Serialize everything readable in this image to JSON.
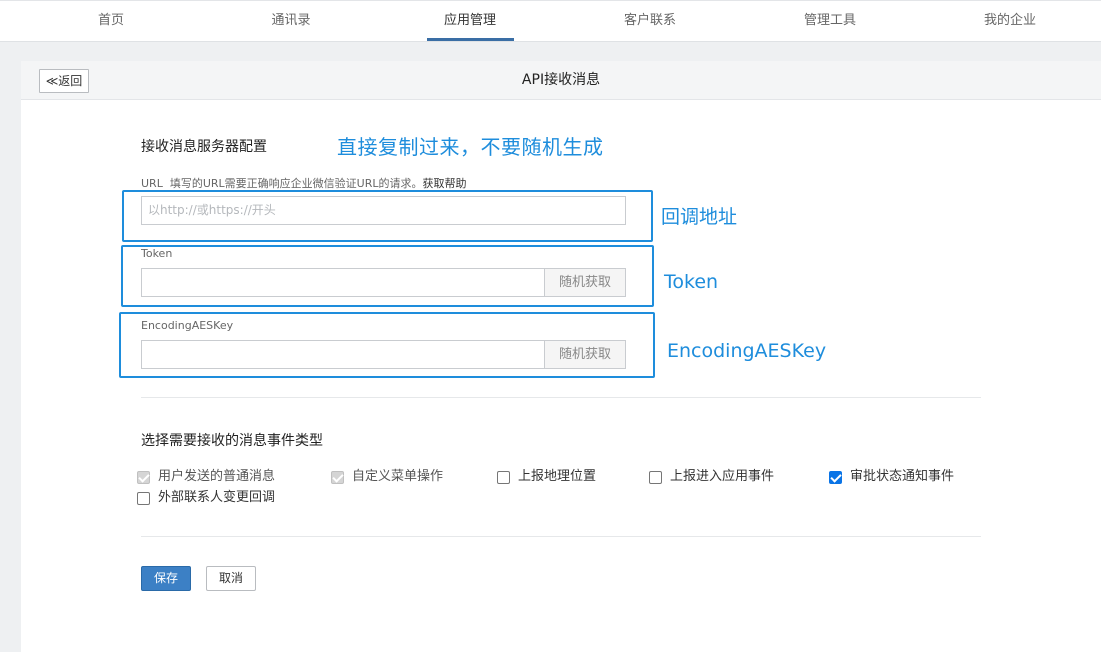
{
  "nav": {
    "items": [
      {
        "label": "首页"
      },
      {
        "label": "通讯录"
      },
      {
        "label": "应用管理"
      },
      {
        "label": "客户联系"
      },
      {
        "label": "管理工具"
      },
      {
        "label": "我的企业"
      }
    ],
    "active_index": 2
  },
  "header": {
    "back_label": "≪返回",
    "title": "API接收消息"
  },
  "server_config": {
    "title": "接收消息服务器配置",
    "url": {
      "label_prefix": "URL",
      "hint": "填写的URL需要正确响应企业微信验证URL的请求。",
      "help_link": "获取帮助",
      "value": "",
      "placeholder": "以http://或https://开头"
    },
    "token": {
      "label": "Token",
      "value": "",
      "random_button": "随机获取"
    },
    "aes_key": {
      "label": "EncodingAESKey",
      "value": "",
      "random_button": "随机获取"
    }
  },
  "annotations": {
    "title_note": "直接复制过来，不要随机生成",
    "url_note": "回调地址",
    "token_note": "Token",
    "aes_note": "EncodingAESKey",
    "color": "#1e8ddc"
  },
  "events": {
    "title": "选择需要接收的消息事件类型",
    "options": [
      {
        "label": "用户发送的普通消息",
        "checked": true,
        "disabled": true
      },
      {
        "label": "自定义菜单操作",
        "checked": true,
        "disabled": true
      },
      {
        "label": "上报地理位置",
        "checked": false,
        "disabled": false
      },
      {
        "label": "上报进入应用事件",
        "checked": false,
        "disabled": false
      },
      {
        "label": "审批状态通知事件",
        "checked": true,
        "disabled": false
      },
      {
        "label": "外部联系人变更回调",
        "checked": false,
        "disabled": false
      }
    ]
  },
  "actions": {
    "save_label": "保存",
    "cancel_label": "取消"
  },
  "colors": {
    "accent": "#3c80c5",
    "nav_underline": "#3a6ea5",
    "annotation": "#1e8ddc"
  }
}
